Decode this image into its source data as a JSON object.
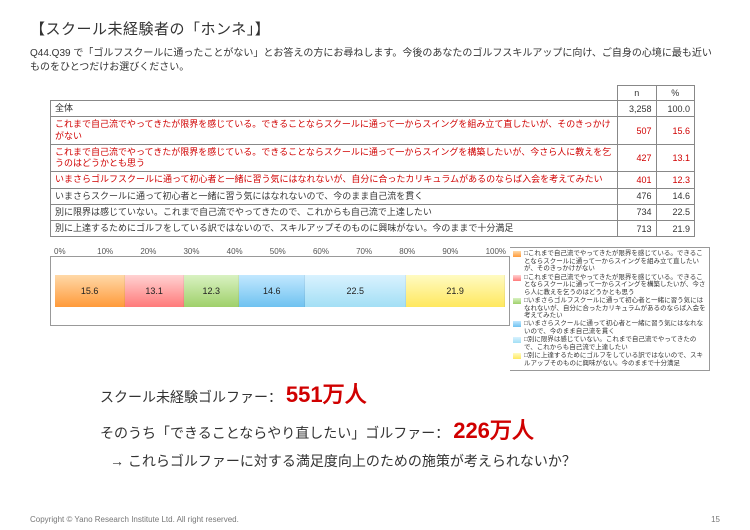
{
  "title": "【スクール未経験者の「ホンネ」】",
  "question": "Q44.Q39 で「ゴルフスクールに通ったことがない」とお答えの方にお尋ねします。今後のあなたのゴルフスキルアップに向け、ご自身の心境に最も近いものをひとつだけお選びください。",
  "headers": {
    "n": "n",
    "pct": "%"
  },
  "total": {
    "label": "全体",
    "n": "3,258",
    "pct": "100.0"
  },
  "rows": [
    {
      "idx": "1",
      "label": "これまで自己流でやってきたが限界を感じている。できることならスクールに通って一からスイングを組み立て直したいが、そのきっかけがない",
      "n": "507",
      "pct": "15.6",
      "red": true
    },
    {
      "idx": "2",
      "label": "これまで自己流でやってきたが限界を感じている。できることならスクールに通って一からスイングを構築したいが、今さら人に教えを乞うのはどうかとも思う",
      "n": "427",
      "pct": "13.1",
      "red": true
    },
    {
      "idx": "3",
      "label": "いまさらゴルフスクールに通って初心者と一緒に習う気にはなれないが、自分に合ったカリキュラムがあるのならば入会を考えてみたい",
      "n": "401",
      "pct": "12.3",
      "red": true
    },
    {
      "idx": "4",
      "label": "いまさらスクールに通って初心者と一緒に習う気にはなれないので、今のまま自己流を貫く",
      "n": "476",
      "pct": "14.6",
      "red": false
    },
    {
      "idx": "5",
      "label": "別に限界は感じていない。これまで自己流でやってきたので、これからも自己流で上達したい",
      "n": "734",
      "pct": "22.5",
      "red": false
    },
    {
      "idx": "6",
      "label": "別に上達するためにゴルフをしている訳ではないので、スキルアップそのものに興味がない。今のままで十分満足",
      "n": "713",
      "pct": "21.9",
      "red": false
    }
  ],
  "chart_data": {
    "type": "bar",
    "categories": [
      "0%",
      "10%",
      "20%",
      "30%",
      "40%",
      "50%",
      "60%",
      "70%",
      "80%",
      "90%",
      "100%"
    ],
    "series": [
      {
        "name": "これまで自己流でやってきたが限界を感じている。できることならスクールに通って一からスイングを組み立て直したいが、そのきっかけがない",
        "value": 15.6
      },
      {
        "name": "これまで自己流でやってきたが限界を感じている。できることならスクールに通って一からスイングを構築したいが、今さら人に教えを乞うのはどうかとも思う",
        "value": 13.1
      },
      {
        "name": "いまさらゴルフスクールに通って初心者と一緒に習う気にはなれないが、自分に合ったカリキュラムがあるのならば入会を考えてみたい",
        "value": 12.3
      },
      {
        "name": "いまさらスクールに通って初心者と一緒に習う気にはなれないので、今のまま自己流を貫く",
        "value": 14.6
      },
      {
        "name": "別に限界は感じていない。これまで自己流でやってきたので、これからも自己流で上達したい",
        "value": 22.5
      },
      {
        "name": "別に上達するためにゴルフをしている訳ではないので、スキルアップそのものに興味がない。今のままで十分満足",
        "value": 21.9
      }
    ],
    "title": "",
    "xlabel": "",
    "ylabel": "",
    "ylim": [
      0,
      100
    ]
  },
  "stats": {
    "line1_label": "スクール未経験ゴルファー：",
    "line1_value": "551万人",
    "line2_label": "そのうち「できることならやり直したい」ゴルファー：",
    "line2_value": "226万人"
  },
  "conclusion": "→ これらゴルファーに対する満足度向上のための施策が考えられないか？",
  "footer": {
    "copyright": "Copyright © Yano Research Institute Ltd. All right reserved.",
    "page": "15"
  }
}
